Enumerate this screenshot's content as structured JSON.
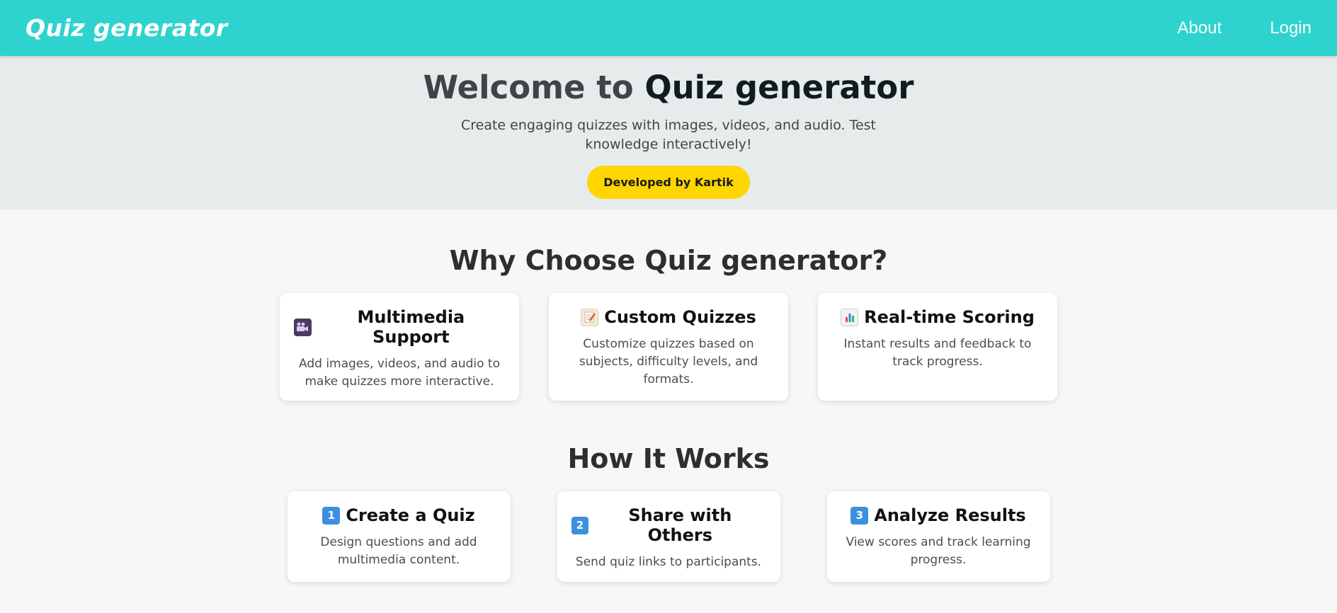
{
  "navbar": {
    "brand": "Quiz generator",
    "links": [
      "About",
      "Login"
    ]
  },
  "hero": {
    "title_prefix": "Welcome to ",
    "title_accent": "Quiz generator",
    "subtitle": "Create engaging quizzes with images, videos, and audio. Test knowledge interactively!",
    "badge": "Developed by Kartik"
  },
  "features": {
    "heading": "Why Choose Quiz generator?",
    "cards": [
      {
        "icon": "movie-camera-icon",
        "title": "Multimedia Support",
        "desc": "Add images, videos, and audio to make quizzes more interactive."
      },
      {
        "icon": "memo-icon",
        "title": "Custom Quizzes",
        "desc": "Customize quizzes based on subjects, difficulty levels, and formats."
      },
      {
        "icon": "bar-chart-icon",
        "title": "Real-time Scoring",
        "desc": "Instant results and feedback to track progress."
      }
    ]
  },
  "how": {
    "heading": "How It Works",
    "steps": [
      {
        "icon": "keycap-1-icon",
        "number": "1",
        "title": "Create a Quiz",
        "desc": "Design questions and add multimedia content."
      },
      {
        "icon": "keycap-2-icon",
        "number": "2",
        "title": "Share with Others",
        "desc": "Send quiz links to participants."
      },
      {
        "icon": "keycap-3-icon",
        "number": "3",
        "title": "Analyze Results",
        "desc": "View scores and track learning progress."
      }
    ]
  },
  "colors": {
    "navbar": "#2ed3cf",
    "hero_bg": "#e6ecec",
    "badge": "#ffd600",
    "page_bg": "#f7f7f7"
  }
}
